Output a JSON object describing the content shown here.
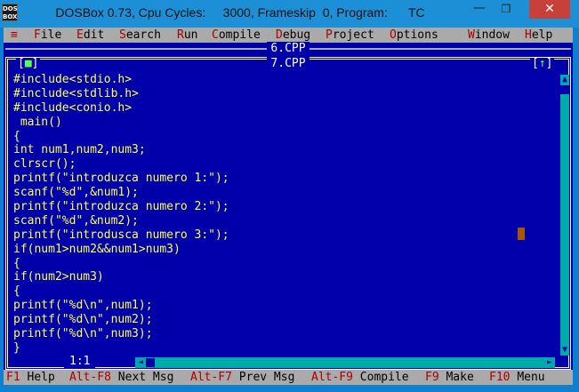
{
  "window": {
    "title": "DOSBox 0.73, Cpu Cycles:     3000, Frameskip  0, Program:      TC",
    "app_icon_text": "DOS BOX",
    "minimize_glyph": "—",
    "maximize_glyph": "❐",
    "close_glyph": "✕"
  },
  "menu": {
    "system": "≡",
    "items": [
      {
        "hot": "F",
        "rest": "ile"
      },
      {
        "hot": "E",
        "rest": "dit"
      },
      {
        "hot": "S",
        "rest": "earch"
      },
      {
        "hot": "R",
        "rest": "un"
      },
      {
        "hot": "C",
        "rest": "ompile"
      },
      {
        "hot": "D",
        "rest": "ebug"
      },
      {
        "hot": "P",
        "rest": "roject"
      },
      {
        "hot": "O",
        "rest": "ptions"
      },
      {
        "hot": "W",
        "rest": "indow"
      },
      {
        "hot": "H",
        "rest": "elp"
      }
    ]
  },
  "editor": {
    "back_window_title": "6.CPP",
    "window_title": "7.CPP",
    "close_box": {
      "open": "[",
      "glyph": "■",
      "close": "]"
    },
    "zoom_box": {
      "open": "[",
      "glyph": "↑",
      "close": "]"
    },
    "position": "1:1",
    "code_lines": [
      "#include<stdio.h>",
      "#include<stdlib.h>",
      "#include<conio.h>",
      " main()",
      "{",
      "int num1,num2,num3;",
      "clrscr();",
      "printf(\"introduzca numero 1:\");",
      "scanf(\"%d\",&num1);",
      "printf(\"introduzca numero 2:\");",
      "scanf(\"%d\",&num2);",
      "printf(\"introdusca numero 3:\");",
      "if(num1>num2&&num1>num3)",
      "{",
      "if(num2>num3)",
      "{",
      "printf(\"%d\\n\",num1);",
      "printf(\"%d\\n\",num2);",
      "printf(\"%d\\n\",num3);",
      "}"
    ]
  },
  "scrollbar": {
    "up_glyph": "▲",
    "down_glyph": "▼",
    "left_glyph": "◄",
    "right_glyph": "►"
  },
  "statusbar": [
    {
      "key": "F1",
      "label": "Help"
    },
    {
      "key": "Alt-F8",
      "label": "Next Msg"
    },
    {
      "key": "Alt-F7",
      "label": "Prev Msg"
    },
    {
      "key": "Alt-F9",
      "label": "Compile"
    },
    {
      "key": "F9",
      "label": "Make"
    },
    {
      "key": "F10",
      "label": "Menu"
    }
  ],
  "colors": {
    "editor_bg": "#0000aa",
    "code_text": "#ffff55",
    "menu_bg": "#aaaaaa",
    "hotkey": "#aa0000",
    "scrollbar": "#00aaaa",
    "cursor": "#aa5500",
    "close_button": "#c7403a"
  }
}
